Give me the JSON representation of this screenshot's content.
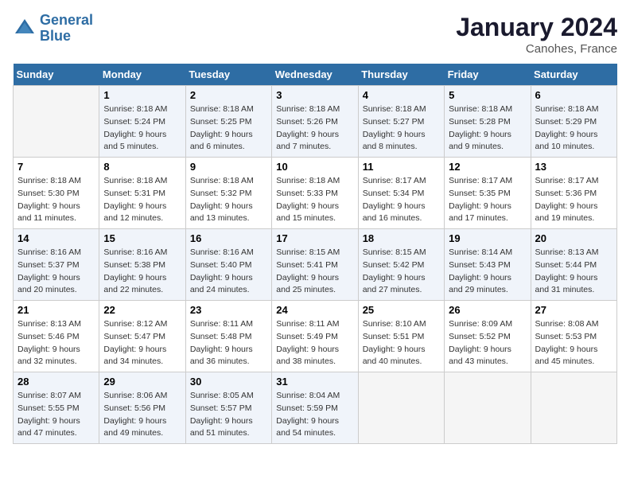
{
  "logo": {
    "line1": "General",
    "line2": "Blue"
  },
  "title": "January 2024",
  "subtitle": "Canohes, France",
  "days_of_week": [
    "Sunday",
    "Monday",
    "Tuesday",
    "Wednesday",
    "Thursday",
    "Friday",
    "Saturday"
  ],
  "weeks": [
    [
      {
        "day": "",
        "sunrise": "",
        "sunset": "",
        "daylight": ""
      },
      {
        "day": "1",
        "sunrise": "Sunrise: 8:18 AM",
        "sunset": "Sunset: 5:24 PM",
        "daylight": "Daylight: 9 hours and 5 minutes."
      },
      {
        "day": "2",
        "sunrise": "Sunrise: 8:18 AM",
        "sunset": "Sunset: 5:25 PM",
        "daylight": "Daylight: 9 hours and 6 minutes."
      },
      {
        "day": "3",
        "sunrise": "Sunrise: 8:18 AM",
        "sunset": "Sunset: 5:26 PM",
        "daylight": "Daylight: 9 hours and 7 minutes."
      },
      {
        "day": "4",
        "sunrise": "Sunrise: 8:18 AM",
        "sunset": "Sunset: 5:27 PM",
        "daylight": "Daylight: 9 hours and 8 minutes."
      },
      {
        "day": "5",
        "sunrise": "Sunrise: 8:18 AM",
        "sunset": "Sunset: 5:28 PM",
        "daylight": "Daylight: 9 hours and 9 minutes."
      },
      {
        "day": "6",
        "sunrise": "Sunrise: 8:18 AM",
        "sunset": "Sunset: 5:29 PM",
        "daylight": "Daylight: 9 hours and 10 minutes."
      }
    ],
    [
      {
        "day": "7",
        "sunrise": "Sunrise: 8:18 AM",
        "sunset": "Sunset: 5:30 PM",
        "daylight": "Daylight: 9 hours and 11 minutes."
      },
      {
        "day": "8",
        "sunrise": "Sunrise: 8:18 AM",
        "sunset": "Sunset: 5:31 PM",
        "daylight": "Daylight: 9 hours and 12 minutes."
      },
      {
        "day": "9",
        "sunrise": "Sunrise: 8:18 AM",
        "sunset": "Sunset: 5:32 PM",
        "daylight": "Daylight: 9 hours and 13 minutes."
      },
      {
        "day": "10",
        "sunrise": "Sunrise: 8:18 AM",
        "sunset": "Sunset: 5:33 PM",
        "daylight": "Daylight: 9 hours and 15 minutes."
      },
      {
        "day": "11",
        "sunrise": "Sunrise: 8:17 AM",
        "sunset": "Sunset: 5:34 PM",
        "daylight": "Daylight: 9 hours and 16 minutes."
      },
      {
        "day": "12",
        "sunrise": "Sunrise: 8:17 AM",
        "sunset": "Sunset: 5:35 PM",
        "daylight": "Daylight: 9 hours and 17 minutes."
      },
      {
        "day": "13",
        "sunrise": "Sunrise: 8:17 AM",
        "sunset": "Sunset: 5:36 PM",
        "daylight": "Daylight: 9 hours and 19 minutes."
      }
    ],
    [
      {
        "day": "14",
        "sunrise": "Sunrise: 8:16 AM",
        "sunset": "Sunset: 5:37 PM",
        "daylight": "Daylight: 9 hours and 20 minutes."
      },
      {
        "day": "15",
        "sunrise": "Sunrise: 8:16 AM",
        "sunset": "Sunset: 5:38 PM",
        "daylight": "Daylight: 9 hours and 22 minutes."
      },
      {
        "day": "16",
        "sunrise": "Sunrise: 8:16 AM",
        "sunset": "Sunset: 5:40 PM",
        "daylight": "Daylight: 9 hours and 24 minutes."
      },
      {
        "day": "17",
        "sunrise": "Sunrise: 8:15 AM",
        "sunset": "Sunset: 5:41 PM",
        "daylight": "Daylight: 9 hours and 25 minutes."
      },
      {
        "day": "18",
        "sunrise": "Sunrise: 8:15 AM",
        "sunset": "Sunset: 5:42 PM",
        "daylight": "Daylight: 9 hours and 27 minutes."
      },
      {
        "day": "19",
        "sunrise": "Sunrise: 8:14 AM",
        "sunset": "Sunset: 5:43 PM",
        "daylight": "Daylight: 9 hours and 29 minutes."
      },
      {
        "day": "20",
        "sunrise": "Sunrise: 8:13 AM",
        "sunset": "Sunset: 5:44 PM",
        "daylight": "Daylight: 9 hours and 31 minutes."
      }
    ],
    [
      {
        "day": "21",
        "sunrise": "Sunrise: 8:13 AM",
        "sunset": "Sunset: 5:46 PM",
        "daylight": "Daylight: 9 hours and 32 minutes."
      },
      {
        "day": "22",
        "sunrise": "Sunrise: 8:12 AM",
        "sunset": "Sunset: 5:47 PM",
        "daylight": "Daylight: 9 hours and 34 minutes."
      },
      {
        "day": "23",
        "sunrise": "Sunrise: 8:11 AM",
        "sunset": "Sunset: 5:48 PM",
        "daylight": "Daylight: 9 hours and 36 minutes."
      },
      {
        "day": "24",
        "sunrise": "Sunrise: 8:11 AM",
        "sunset": "Sunset: 5:49 PM",
        "daylight": "Daylight: 9 hours and 38 minutes."
      },
      {
        "day": "25",
        "sunrise": "Sunrise: 8:10 AM",
        "sunset": "Sunset: 5:51 PM",
        "daylight": "Daylight: 9 hours and 40 minutes."
      },
      {
        "day": "26",
        "sunrise": "Sunrise: 8:09 AM",
        "sunset": "Sunset: 5:52 PM",
        "daylight": "Daylight: 9 hours and 43 minutes."
      },
      {
        "day": "27",
        "sunrise": "Sunrise: 8:08 AM",
        "sunset": "Sunset: 5:53 PM",
        "daylight": "Daylight: 9 hours and 45 minutes."
      }
    ],
    [
      {
        "day": "28",
        "sunrise": "Sunrise: 8:07 AM",
        "sunset": "Sunset: 5:55 PM",
        "daylight": "Daylight: 9 hours and 47 minutes."
      },
      {
        "day": "29",
        "sunrise": "Sunrise: 8:06 AM",
        "sunset": "Sunset: 5:56 PM",
        "daylight": "Daylight: 9 hours and 49 minutes."
      },
      {
        "day": "30",
        "sunrise": "Sunrise: 8:05 AM",
        "sunset": "Sunset: 5:57 PM",
        "daylight": "Daylight: 9 hours and 51 minutes."
      },
      {
        "day": "31",
        "sunrise": "Sunrise: 8:04 AM",
        "sunset": "Sunset: 5:59 PM",
        "daylight": "Daylight: 9 hours and 54 minutes."
      },
      {
        "day": "",
        "sunrise": "",
        "sunset": "",
        "daylight": ""
      },
      {
        "day": "",
        "sunrise": "",
        "sunset": "",
        "daylight": ""
      },
      {
        "day": "",
        "sunrise": "",
        "sunset": "",
        "daylight": ""
      }
    ]
  ]
}
